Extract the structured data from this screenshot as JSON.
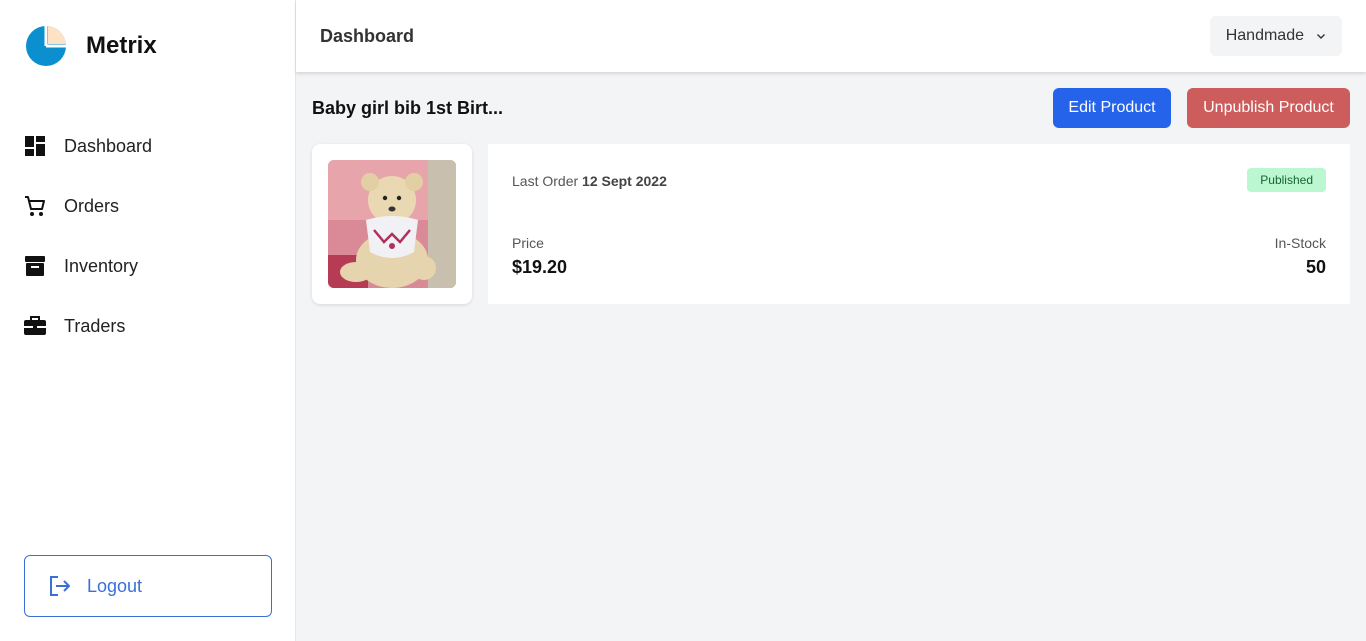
{
  "brand": {
    "name": "Metrix",
    "logo_colors": [
      "#0b8fce",
      "#fde2c6"
    ]
  },
  "sidebar": {
    "items": [
      {
        "label": "Dashboard",
        "icon": "dashboard-icon"
      },
      {
        "label": "Orders",
        "icon": "cart-icon"
      },
      {
        "label": "Inventory",
        "icon": "archive-icon"
      },
      {
        "label": "Traders",
        "icon": "briefcase-icon"
      }
    ],
    "logout_label": "Logout"
  },
  "header": {
    "title": "Dashboard",
    "store_select": "Handmade"
  },
  "product": {
    "title": "Baby girl bib 1st Birt...",
    "edit_label": "Edit Product",
    "unpublish_label": "Unpublish Product",
    "last_order_label": "Last Order",
    "last_order_date": "12 Sept 2022",
    "status": "Published",
    "price_label": "Price",
    "price": "$19.20",
    "stock_label": "In-Stock",
    "stock": "50"
  },
  "colors": {
    "primary": "#2563eb",
    "danger": "#cd5c5c",
    "success_bg": "#bbf7d0",
    "success_text": "#166534",
    "logout": "#3b6fd8"
  }
}
